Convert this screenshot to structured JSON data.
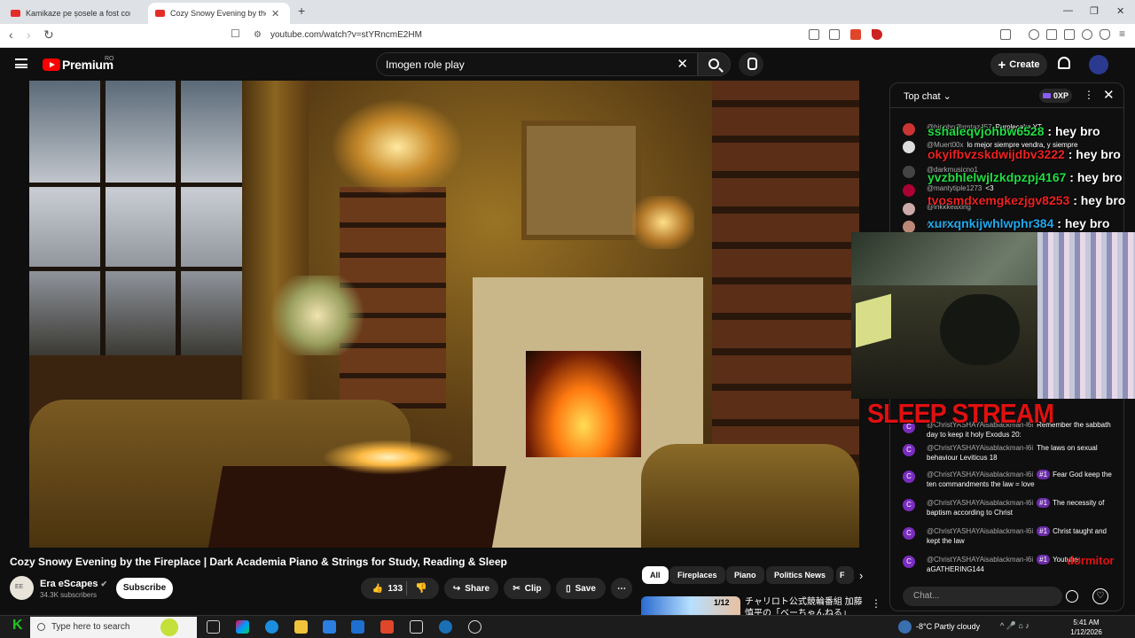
{
  "browser": {
    "tabs": [
      {
        "title": "Kamikaze pe șosele a fost confiscat ..."
      },
      {
        "title": "Cozy Snowy Evening by the F..."
      }
    ],
    "new_tab": "+",
    "url": "youtube.com/watch?v=stYRncmE2HM"
  },
  "youtube": {
    "brand": "Premium",
    "region": "RO",
    "search_value": "Imogen role play",
    "create_label": "Create"
  },
  "video": {
    "title": "Cozy Snowy Evening by the Fireplace | Dark Academia Piano & Strings for Study, Reading & Sleep",
    "channel": "Era eScapes",
    "subscribers": "34.3K subscribers",
    "subscribe_label": "Subscribe",
    "likes": "133",
    "share_label": "Share",
    "clip_label": "Clip",
    "save_label": "Save"
  },
  "overlay": {
    "sleep_label": "SLEEP STREAM",
    "dormitor_label": "dormitor",
    "names": [
      "sshaleqvjohbw6528",
      "okyifbvzskdwijdbv3222",
      "yvzbhlelwjlzkdpzpj4167",
      "tvosmdxemgkezjgv8253",
      "xurxqnkijwhlwphr384"
    ],
    "hey": ": hey bro"
  },
  "chat": {
    "header": "Top chat",
    "xp": "0XP",
    "top_messages": [
      {
        "author": "@hinnbn@rmtaz457",
        "text": "Purplecake YT"
      },
      {
        "author": "@Muert00x",
        "text": "lo mejor siempre vendra, y siempre"
      },
      {
        "author": "@darkmusicno1",
        "text": ""
      },
      {
        "author": "@mantytiple1273",
        "text": "<3"
      },
      {
        "author": "@lhkkkeaxing",
        "text": ""
      },
      {
        "author": "@yadehhurd?",
        "text": ""
      }
    ],
    "messages": [
      {
        "author": "@ChristYASHAYAisablackman-l6i",
        "badge": "",
        "text": "Remember the sabbath day to keep it holy Exodus 20:"
      },
      {
        "author": "@ChristYASHAYAisablackman-l6i",
        "badge": "",
        "text": "The laws on sexual behaviour Leviticus 18"
      },
      {
        "author": "@ChristYASHAYAisablackman-l6i",
        "badge": "#1",
        "text": "Fear God keep the ten commandments the law = love"
      },
      {
        "author": "@ChristYASHAYAisablackman-l6i",
        "badge": "#1",
        "text": "The necessity of baptism according to Christ"
      },
      {
        "author": "@ChristYASHAYAisablackman-l6i",
        "badge": "#1",
        "text": "Christ taught and kept the law"
      },
      {
        "author": "@ChristYASHAYAisablackman-l6i",
        "badge": "#1",
        "text": "Youtube: aGATHERING144"
      }
    ],
    "avatar_letter": "C",
    "input_placeholder": "Chat..."
  },
  "chips": [
    "All",
    "Fireplaces",
    "Piano",
    "Politics News",
    "F"
  ],
  "recommendation": {
    "title": "チャリロト公式競輪番組 加藤慎平の「ベーちゃんねる」",
    "badge": "1/12"
  },
  "taskbar": {
    "search_placeholder": "Type here to search",
    "weather": "-8°C  Partly cloudy",
    "time": "5:41 AM",
    "date": "1/12/2026",
    "start_glyph": "K"
  },
  "colors": {
    "sleep_stream": "#e01010",
    "name_colors": [
      "#22dd44",
      "#ee2222",
      "#22dd44",
      "#ee2222",
      "#22aaee"
    ]
  }
}
